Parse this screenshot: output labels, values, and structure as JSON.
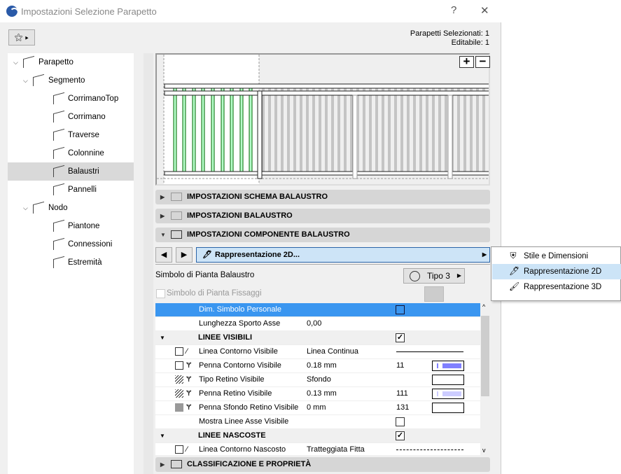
{
  "window": {
    "title": "Impostazioni Selezione Parapetto",
    "help": "?",
    "close": "✕"
  },
  "info": {
    "selected": "Parapetti Selezionati: 1",
    "editable": "Editabile: 1"
  },
  "tree": [
    {
      "label": "Parapetto",
      "level": 0,
      "expanded": true
    },
    {
      "label": "Segmento",
      "level": 1,
      "expanded": true
    },
    {
      "label": "CorrimanoTop",
      "level": 2
    },
    {
      "label": "Corrimano",
      "level": 2
    },
    {
      "label": "Traverse",
      "level": 2
    },
    {
      "label": "Colonnine",
      "level": 2
    },
    {
      "label": "Balaustri",
      "level": 2,
      "selected": true
    },
    {
      "label": "Pannelli",
      "level": 2
    },
    {
      "label": "Nodo",
      "level": 1,
      "expanded": true
    },
    {
      "label": "Piantone",
      "level": 2
    },
    {
      "label": "Connessioni",
      "level": 2
    },
    {
      "label": "Estremità",
      "level": 2
    }
  ],
  "preview": {
    "zoom_in": "+",
    "zoom_out": "−",
    "highlight_color": "#b8ffcc"
  },
  "sections": {
    "schema": "IMPOSTAZIONI SCHEMA BALAUSTRO",
    "balaustro": "IMPOSTAZIONI BALAUSTRO",
    "componente": "IMPOSTAZIONI COMPONENTE BALAUSTRO",
    "classificazione": "CLASSIFICAZIONE E PROPRIETÀ"
  },
  "nav": {
    "prev": "◀",
    "next": "▶",
    "current": "Rappresentazione 2D..."
  },
  "popup": [
    {
      "label": "Stile e Dimensioni",
      "icon": "railing-dimensions-icon"
    },
    {
      "label": "Rappresentazione 2D",
      "icon": "pen-icon",
      "highlighted": true
    },
    {
      "label": "Rappresentazione 3D",
      "icon": "brush-icon"
    }
  ],
  "symbol": {
    "label": "Simbolo di Pianta Balaustro",
    "value": "Tipo 3",
    "fixings_label": "Simbolo di Pianta Fissaggi"
  },
  "rows": [
    {
      "name": "Dim. Simbolo Personale",
      "checkbox": false,
      "highlight": true
    },
    {
      "name": "Lunghezza Sporto Asse",
      "value": "0,00"
    },
    {
      "name": "LINEE VISIBILI",
      "group": true,
      "checkbox": true
    },
    {
      "name": "Linea Contorno Visibile",
      "value": "Linea Continua",
      "line": "solid"
    },
    {
      "name": "Penna Contorno Visibile",
      "value": "0.18 mm",
      "num": "11",
      "pen": "#8080ff"
    },
    {
      "name": "Tipo Retino Visibile",
      "value": "Sfondo",
      "pen": "none"
    },
    {
      "name": "Penna Retino Visibile",
      "value": "0.13 mm",
      "num": "111",
      "pen": "#ccccff"
    },
    {
      "name": "Penna Sfondo Retino Visibile",
      "value": "0 mm",
      "num": "131",
      "pen": "none"
    },
    {
      "name": "Mostra Linee Asse Visibile",
      "checkbox": false
    },
    {
      "name": "LINEE NASCOSTE",
      "group": true,
      "checkbox": true
    },
    {
      "name": "Linea Contorno Nascosto",
      "value": "Tratteggiata Fitta",
      "line": "dashed"
    }
  ]
}
